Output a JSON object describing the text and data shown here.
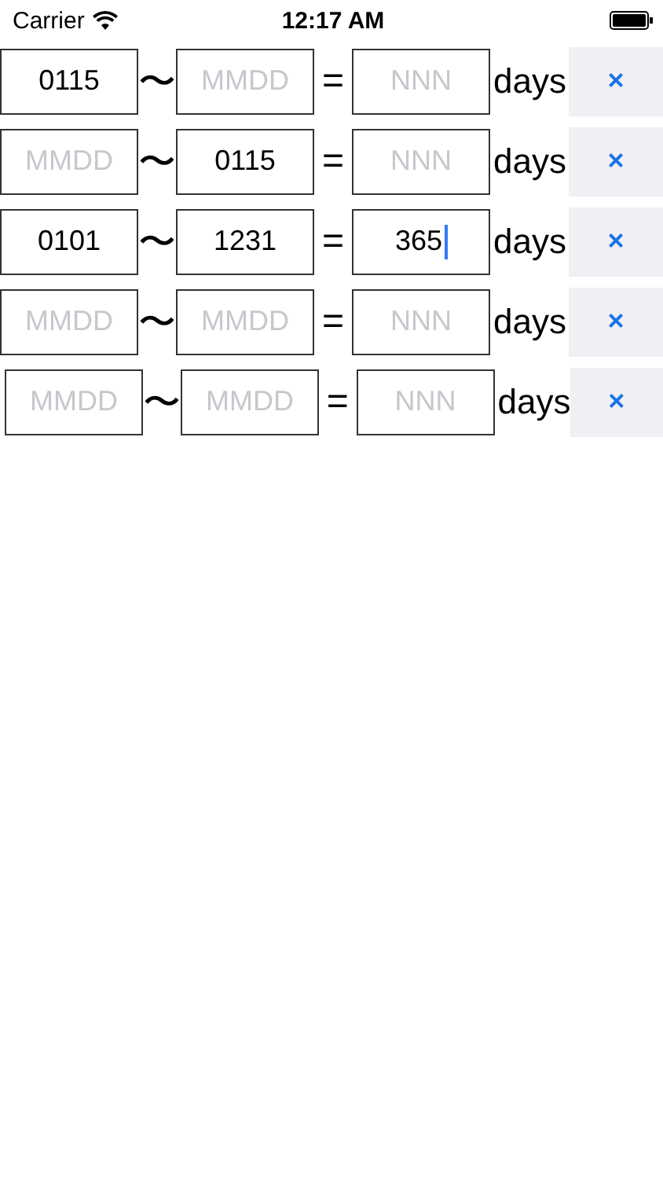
{
  "status_bar": {
    "carrier": "Carrier",
    "time": "12:17 AM"
  },
  "rows": [
    {
      "start": {
        "value": "0115",
        "focused": false
      },
      "separator": "〜",
      "end": {
        "placeholder": "MMDD",
        "focused": false
      },
      "equals": "=",
      "result": {
        "placeholder": "NNN",
        "focused": false
      },
      "unit": "days",
      "clear": "×"
    },
    {
      "start": {
        "placeholder": "MMDD",
        "focused": false
      },
      "separator": "〜",
      "end": {
        "value": "0115",
        "focused": false
      },
      "equals": "=",
      "result": {
        "placeholder": "NNN",
        "focused": false
      },
      "unit": "days",
      "clear": "×"
    },
    {
      "start": {
        "value": "0101",
        "focused": false
      },
      "separator": "〜",
      "end": {
        "value": "1231",
        "focused": false
      },
      "equals": "=",
      "result": {
        "value": "365",
        "focused": true
      },
      "unit": "days",
      "clear": "×"
    },
    {
      "start": {
        "placeholder": "MMDD",
        "focused": false
      },
      "separator": "〜",
      "end": {
        "placeholder": "MMDD",
        "focused": false
      },
      "equals": "=",
      "result": {
        "placeholder": "NNN",
        "focused": false
      },
      "unit": "days",
      "clear": "×"
    },
    {
      "start": {
        "placeholder": "MMDD",
        "focused": false
      },
      "separator": "〜",
      "end": {
        "placeholder": "MMDD",
        "focused": false
      },
      "equals": "=",
      "result": {
        "placeholder": "NNN",
        "focused": false
      },
      "unit": "days",
      "clear": "×"
    }
  ]
}
